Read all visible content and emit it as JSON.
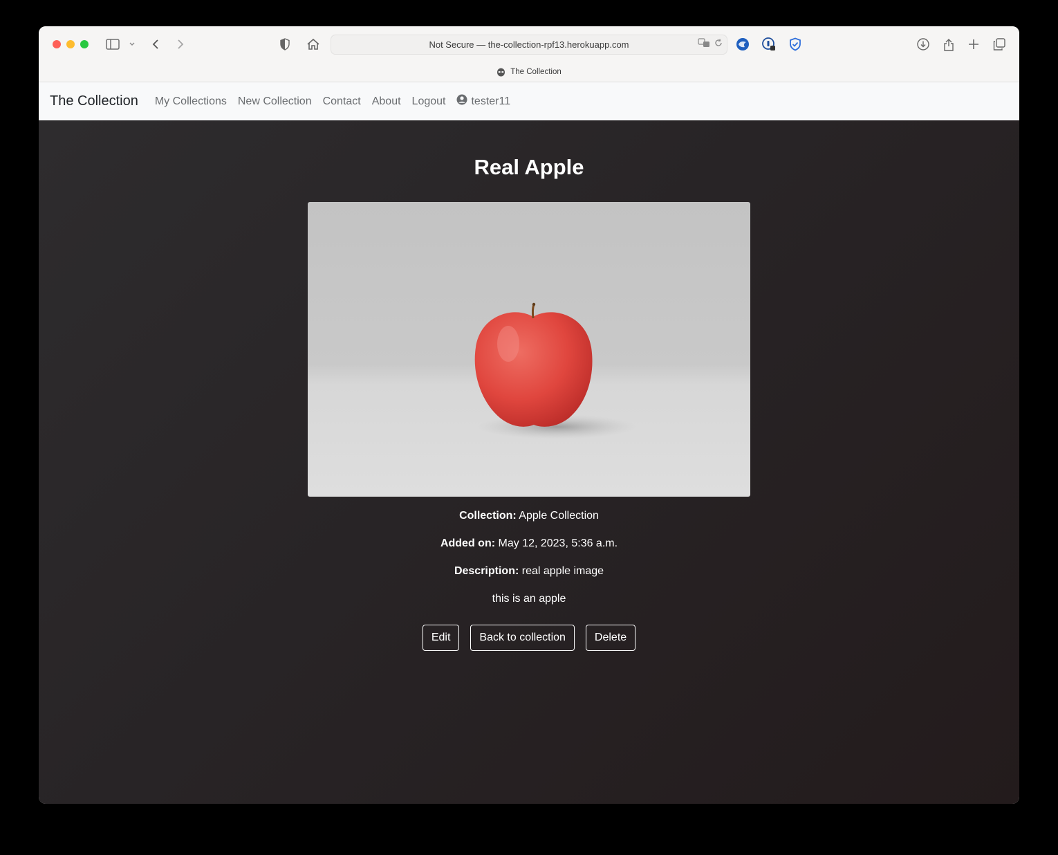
{
  "browser": {
    "address_text": "Not Secure — the-collection-rpf13.herokuapp.com",
    "tab_title": "The Collection"
  },
  "nav": {
    "brand": "The Collection",
    "links": [
      "My Collections",
      "New Collection",
      "Contact",
      "About",
      "Logout"
    ],
    "username": "tester11"
  },
  "item": {
    "title": "Real Apple",
    "collection_label": "Collection:",
    "collection_value": "Apple Collection",
    "added_label": "Added on:",
    "added_value": "May 12, 2023, 5:36 a.m.",
    "description_label": "Description:",
    "description_value": "real apple image",
    "note": "this is an apple"
  },
  "buttons": {
    "edit": "Edit",
    "back": "Back to collection",
    "delete": "Delete"
  }
}
